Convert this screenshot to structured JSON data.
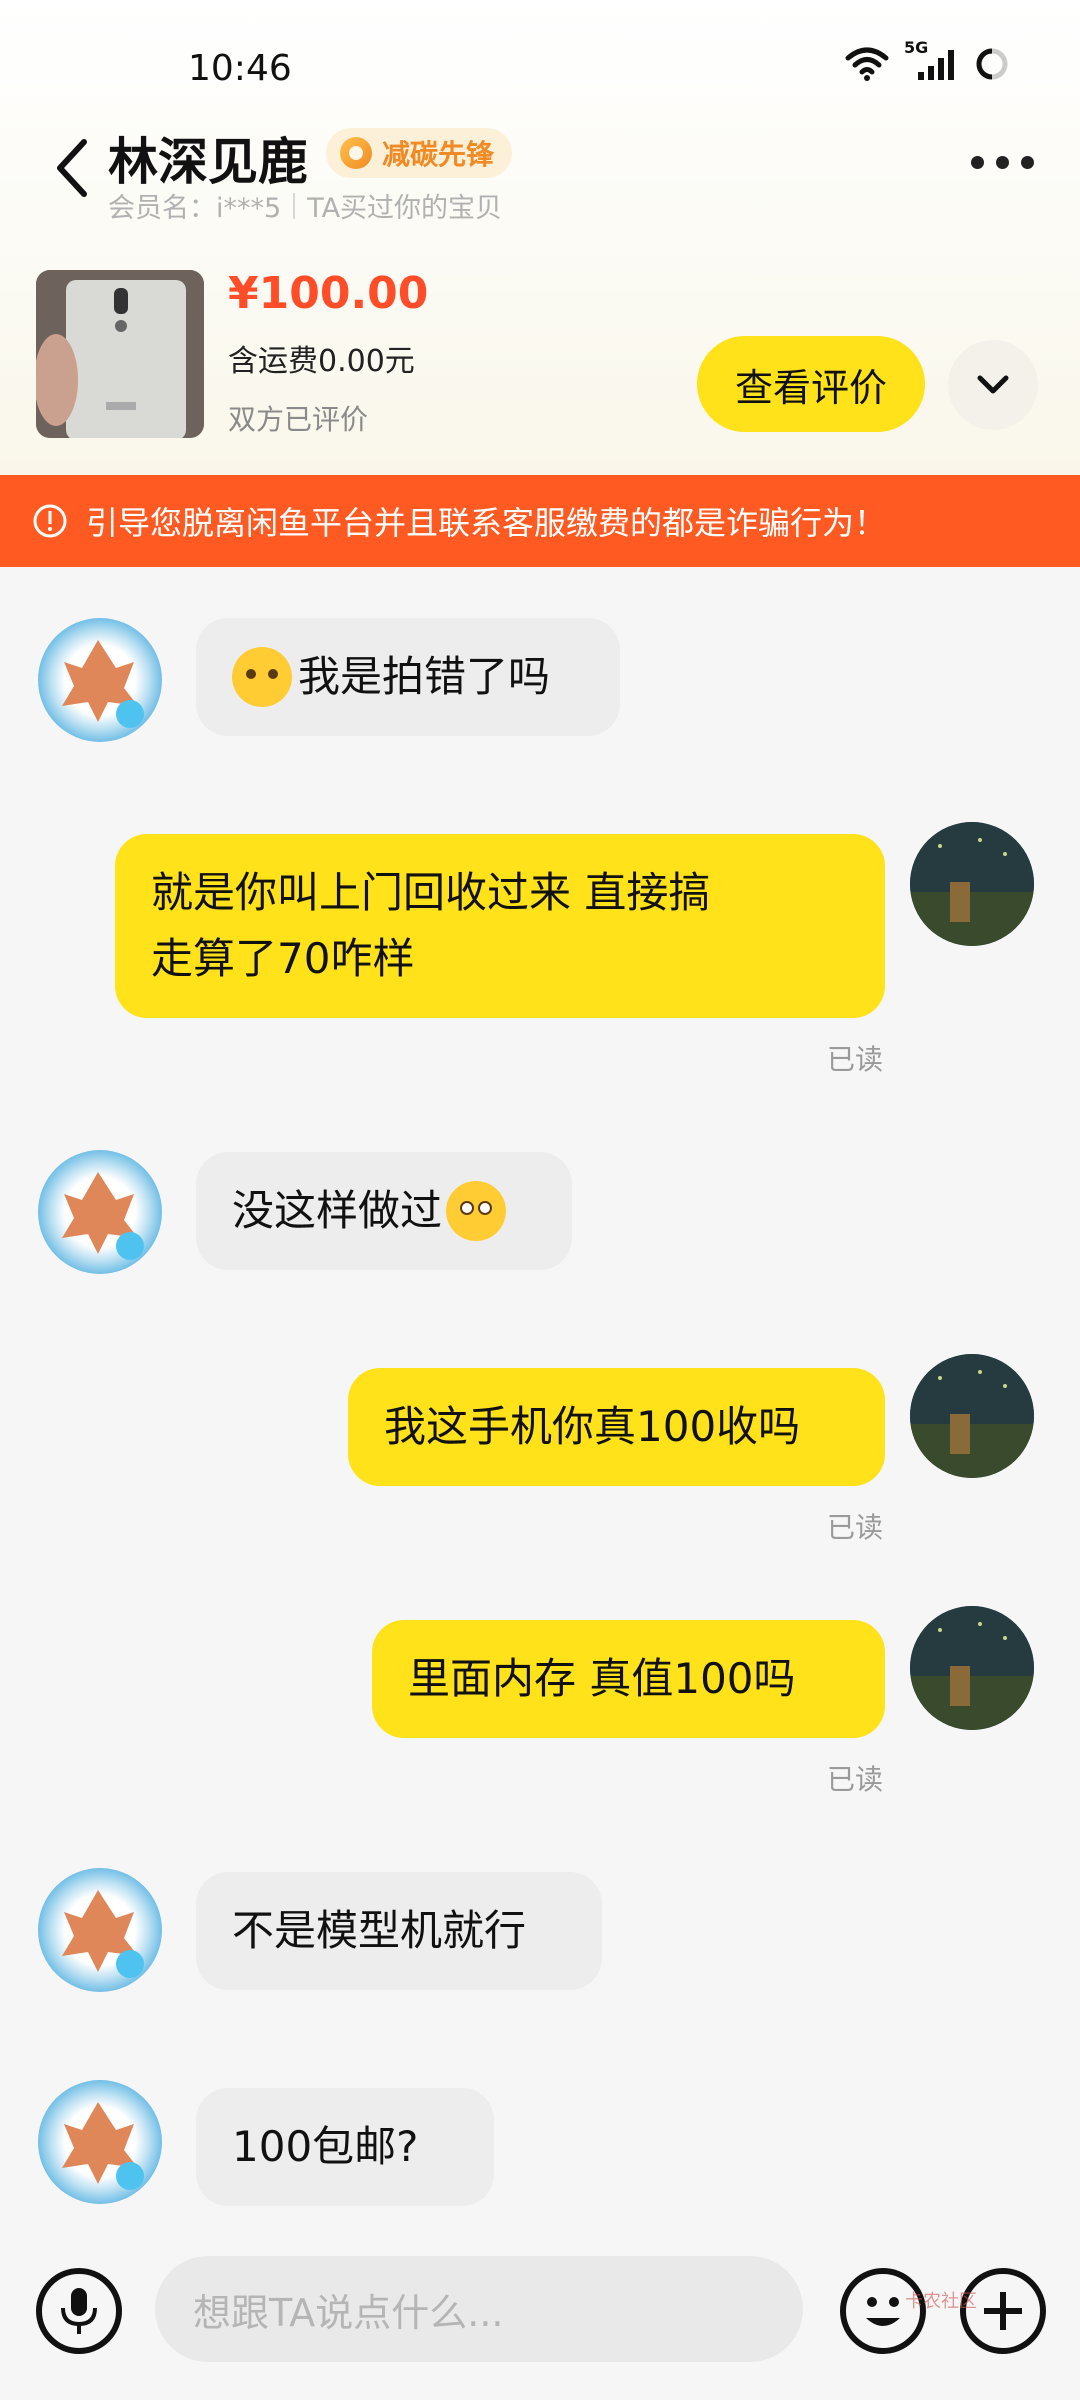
{
  "status_bar": {
    "time": "10:46",
    "network": "5G"
  },
  "header": {
    "name": "林深见鹿",
    "badge": "减碳先锋",
    "member": "会员名：i***5",
    "relation": "TA买过你的宝贝"
  },
  "product": {
    "price": "¥100.00",
    "shipping": "含运费0.00元",
    "rated": "双方已评价",
    "review_button": "查看评价"
  },
  "warning": "引导您脱离闲鱼平台并且联系客服缴费的都是诈骗行为！",
  "messages": [
    {
      "from": "other",
      "text": "我是拍错了吗",
      "emoji": "laugh-cry-emoji"
    },
    {
      "from": "self",
      "line1": "就是你叫上门回收过来   直接搞",
      "line2": "走算了70咋样",
      "status": "已读"
    },
    {
      "from": "other",
      "text": "没这样做过",
      "emoji": "flushed-emoji"
    },
    {
      "from": "self",
      "text": "我这手机你真100收吗",
      "status": "已读"
    },
    {
      "from": "self",
      "text": "里面内存  真值100吗",
      "status": "已读"
    },
    {
      "from": "other",
      "text": "不是模型机就行"
    },
    {
      "from": "other",
      "text": "100包邮?"
    }
  ],
  "input": {
    "placeholder": "想跟TA说点什么..."
  },
  "watermark": "卡农社区",
  "colors": {
    "accent": "#ffe21a",
    "warning": "#ff5a22",
    "price": "#ff4d2a"
  }
}
